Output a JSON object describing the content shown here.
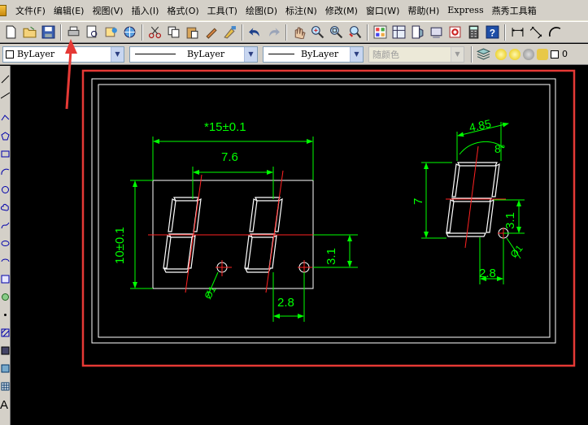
{
  "menu": {
    "items": [
      "文件(F)",
      "编辑(E)",
      "视图(V)",
      "插入(I)",
      "格式(O)",
      "工具(T)",
      "绘图(D)",
      "标注(N)",
      "修改(M)",
      "窗口(W)",
      "帮助(H)",
      "Express",
      "燕秀工具箱"
    ]
  },
  "toolbar": {
    "icons": [
      "new-icon",
      "open-icon",
      "save-icon",
      "print-icon",
      "plot-preview-icon",
      "publish-icon",
      "3d-dwf-icon",
      "cut-icon",
      "copy-icon",
      "paste-icon",
      "match-properties-icon",
      "block-editor-icon",
      "undo-icon",
      "redo-icon",
      "pan-icon",
      "zoom-realtime-icon",
      "zoom-window-icon",
      "zoom-previous-icon",
      "properties-icon",
      "design-center-icon",
      "tool-palettes-icon",
      "sheet-set-icon",
      "markup-icon",
      "calculator-icon",
      "help-icon",
      "linear-dim-icon",
      "aligned-dim-icon",
      "arc-length-icon"
    ]
  },
  "properties": {
    "color": "ByLayer",
    "linetype": "ByLayer",
    "lineweight": "ByLayer",
    "plotstyle": "随颜色",
    "layer": "0"
  },
  "drawing": {
    "dims": {
      "total_width": "*15±0.1",
      "digit_pitch": "7.6",
      "height": "10±0.1",
      "dp_offset": "3.1",
      "dp_pitch": "2.8",
      "dp_dia": "Ø1",
      "single_width": "4.85",
      "slant": "8°",
      "single_height": "7",
      "single_dp_offset": "3.1",
      "single_dp_pitch": "2.8",
      "single_dp_dia": "Ø1"
    },
    "colors": {
      "background": "#000000",
      "outline": "#ffffff",
      "dimension": "#00ff00",
      "centerline": "#ff0000",
      "highlight_box": "#e53935"
    }
  }
}
